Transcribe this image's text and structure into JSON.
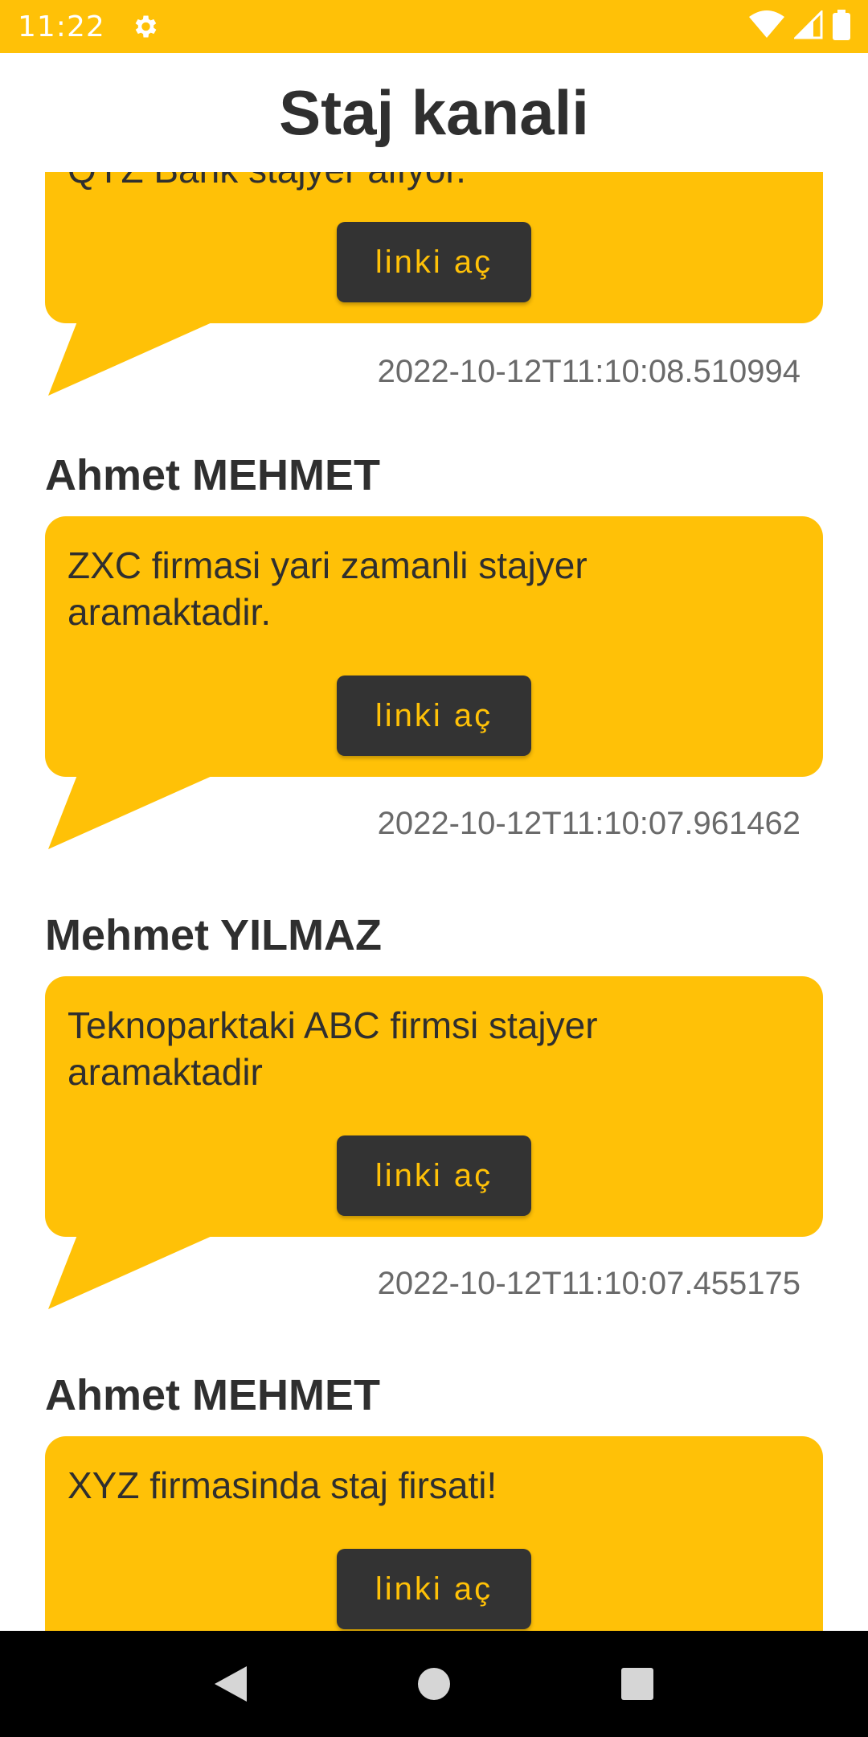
{
  "status_bar": {
    "time": "11:22",
    "icons": [
      "settings-gear-icon",
      "wifi-icon",
      "signal-icon",
      "battery-icon"
    ],
    "color": "#FFC107"
  },
  "app_bar": {
    "title": "Staj kanali"
  },
  "messages": [
    {
      "sender": "",
      "text": "QYZ Bank stajyer alıyor.",
      "button": "linki aç",
      "timestamp": "2022-10-12T11:10:08.510994"
    },
    {
      "sender": "Ahmet MEHMET",
      "text": "ZXC firmasi yari zamanli stajyer aramaktadir.",
      "button": "linki aç",
      "timestamp": "2022-10-12T11:10:07.961462"
    },
    {
      "sender": "Mehmet YILMAZ",
      "text": "Teknoparktaki ABC firmsi stajyer aramaktadir",
      "button": "linki aç",
      "timestamp": "2022-10-12T11:10:07.455175"
    },
    {
      "sender": "Ahmet MEHMET",
      "text": "XYZ firmasinda staj firsati!",
      "button": "linki aç",
      "timestamp": ""
    }
  ],
  "colors": {
    "accent": "#FFC107",
    "button_bg": "#333333",
    "text": "#2f2f2f",
    "timestamp": "#6a6a6a"
  },
  "nav_bar": {
    "icons": [
      "back-triangle-icon",
      "home-circle-icon",
      "recents-square-icon"
    ]
  }
}
